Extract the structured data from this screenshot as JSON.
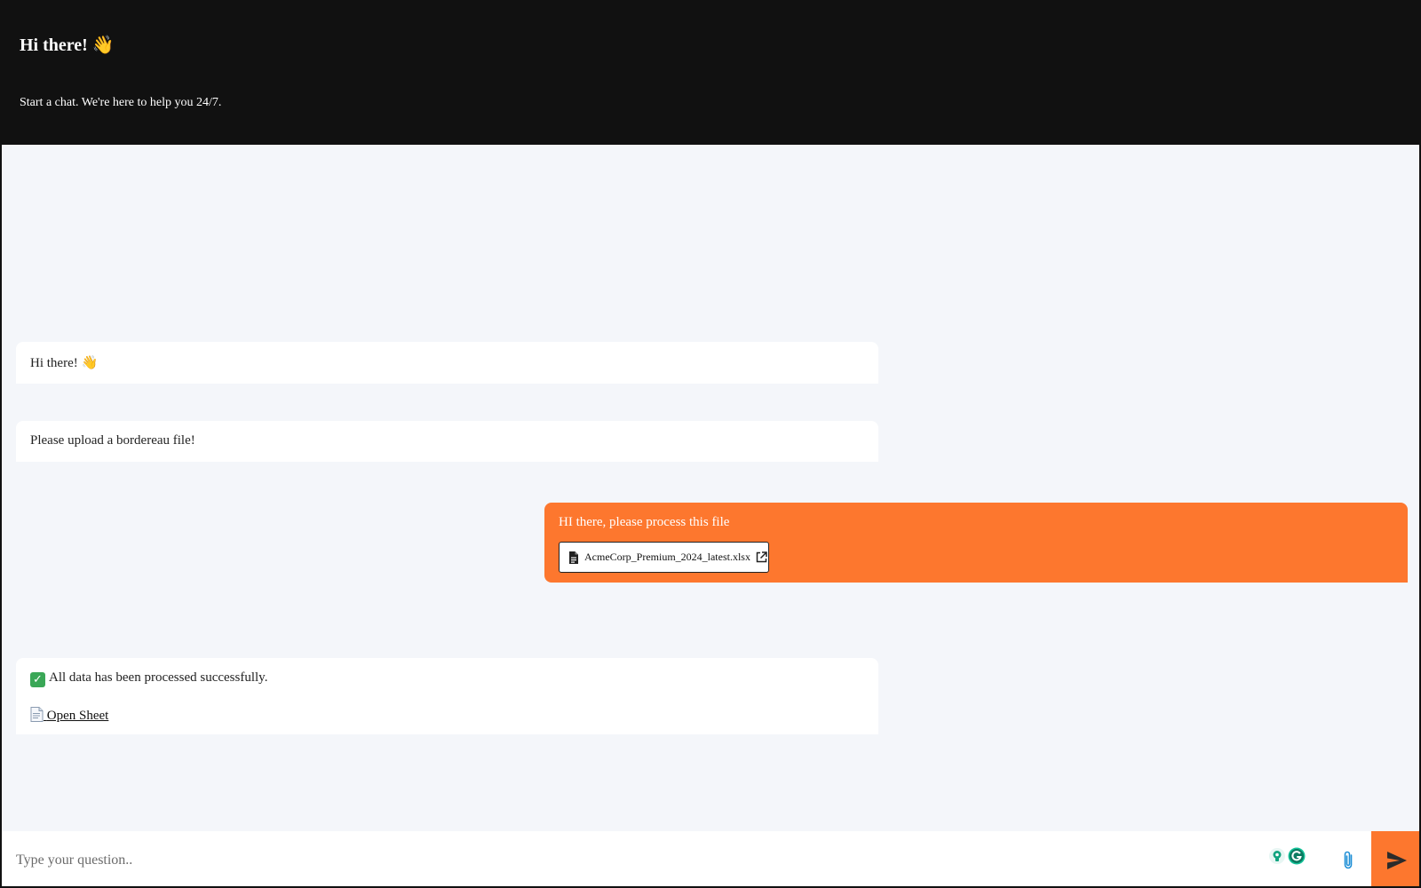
{
  "header": {
    "title": "Hi there! 👋",
    "subtitle": "Start a chat. We're here to help you 24/7."
  },
  "messages": {
    "bot_greeting": "Hi there! 👋",
    "bot_prompt": "Please upload a bordereau file!",
    "user_message": "HI there, please process this file",
    "user_attachment": "AcmeCorp_Premium_2024_latest.xlsx",
    "bot_result": "All data has been processed successfully.",
    "bot_link_label": "Open Sheet"
  },
  "input": {
    "placeholder": "Type your question.."
  },
  "icons": {
    "file": "file-icon",
    "external": "external-link-icon",
    "check": "check-icon",
    "sheet": "page-icon",
    "attach": "paperclip-icon",
    "send": "send-icon",
    "extension_a": "lightbulb-icon",
    "extension_b": "grammarly-icon"
  },
  "colors": {
    "header_bg": "#111111",
    "accent": "#fd772e",
    "chat_bg": "#f4f6fa",
    "bubble_bg": "#ffffff",
    "attach_icon": "#1f8fd6",
    "check_green": "#3aa757"
  }
}
